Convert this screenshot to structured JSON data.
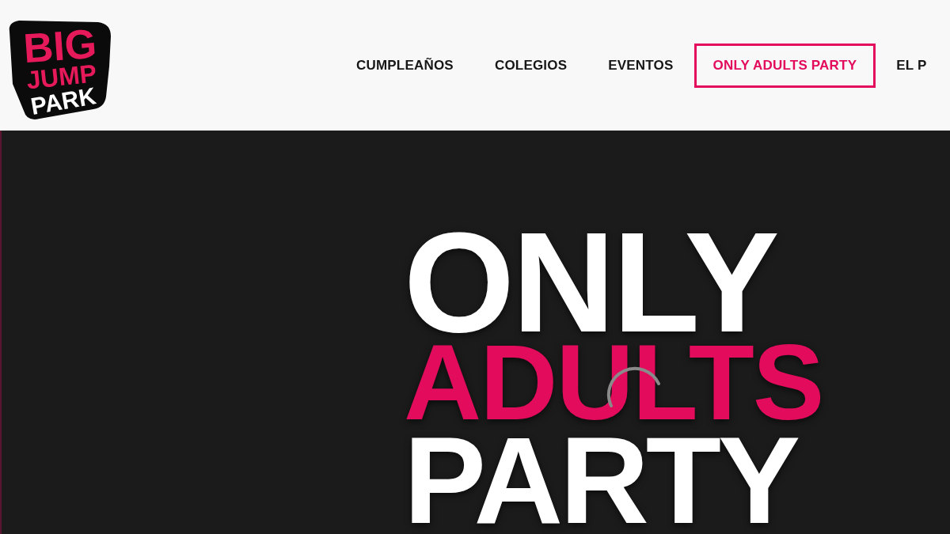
{
  "logo": {
    "lines": [
      "BIG",
      "JUMP",
      "PARK"
    ]
  },
  "nav": [
    {
      "label": "CUMPLEAÑOS",
      "selected": false
    },
    {
      "label": "COLEGIOS",
      "selected": false
    },
    {
      "label": "EVENTOS",
      "selected": false
    },
    {
      "label": "ONLY ADULTS PARTY",
      "selected": true
    },
    {
      "label": "EL P",
      "selected": false
    }
  ],
  "hero": {
    "lines": [
      {
        "text": "ONLY",
        "kind": "big"
      },
      {
        "text": "ADULTS",
        "kind": "accent"
      },
      {
        "text": "PARTY",
        "kind": "big"
      }
    ],
    "loading": true
  }
}
